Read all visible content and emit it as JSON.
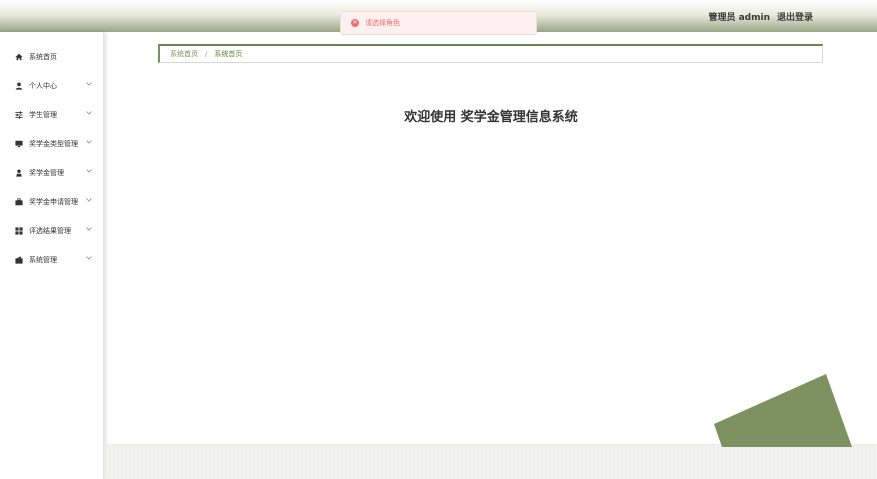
{
  "header": {
    "user_label": "管理员 admin",
    "logout_label": "退出登录"
  },
  "toast": {
    "message": "请选择角色",
    "icon": "error-circle-icon",
    "color": "#f56c6c"
  },
  "sidebar": {
    "items": [
      {
        "label": "系统首页",
        "icon": "home-icon",
        "has_submenu": false
      },
      {
        "label": "个人中心",
        "icon": "user-icon",
        "has_submenu": true
      },
      {
        "label": "学生管理",
        "icon": "sliders-icon",
        "has_submenu": true
      },
      {
        "label": "奖学金类型管理",
        "icon": "monitor-icon",
        "has_submenu": true
      },
      {
        "label": "奖学金管理",
        "icon": "person-icon",
        "has_submenu": true
      },
      {
        "label": "奖学金申请管理",
        "icon": "briefcase-icon",
        "has_submenu": true
      },
      {
        "label": "评选结果管理",
        "icon": "grid-icon",
        "has_submenu": true
      },
      {
        "label": "系统管理",
        "icon": "wallet-icon",
        "has_submenu": true
      }
    ]
  },
  "breadcrumb": {
    "home": "系统首页",
    "separator": "/",
    "current": "系统首页"
  },
  "main": {
    "welcome_title": "欢迎使用 奖学金管理信息系统"
  },
  "colors": {
    "accent": "#7d8f5c",
    "decoration": "#7e9161",
    "topbar_gradient_end": "#9aa585"
  }
}
